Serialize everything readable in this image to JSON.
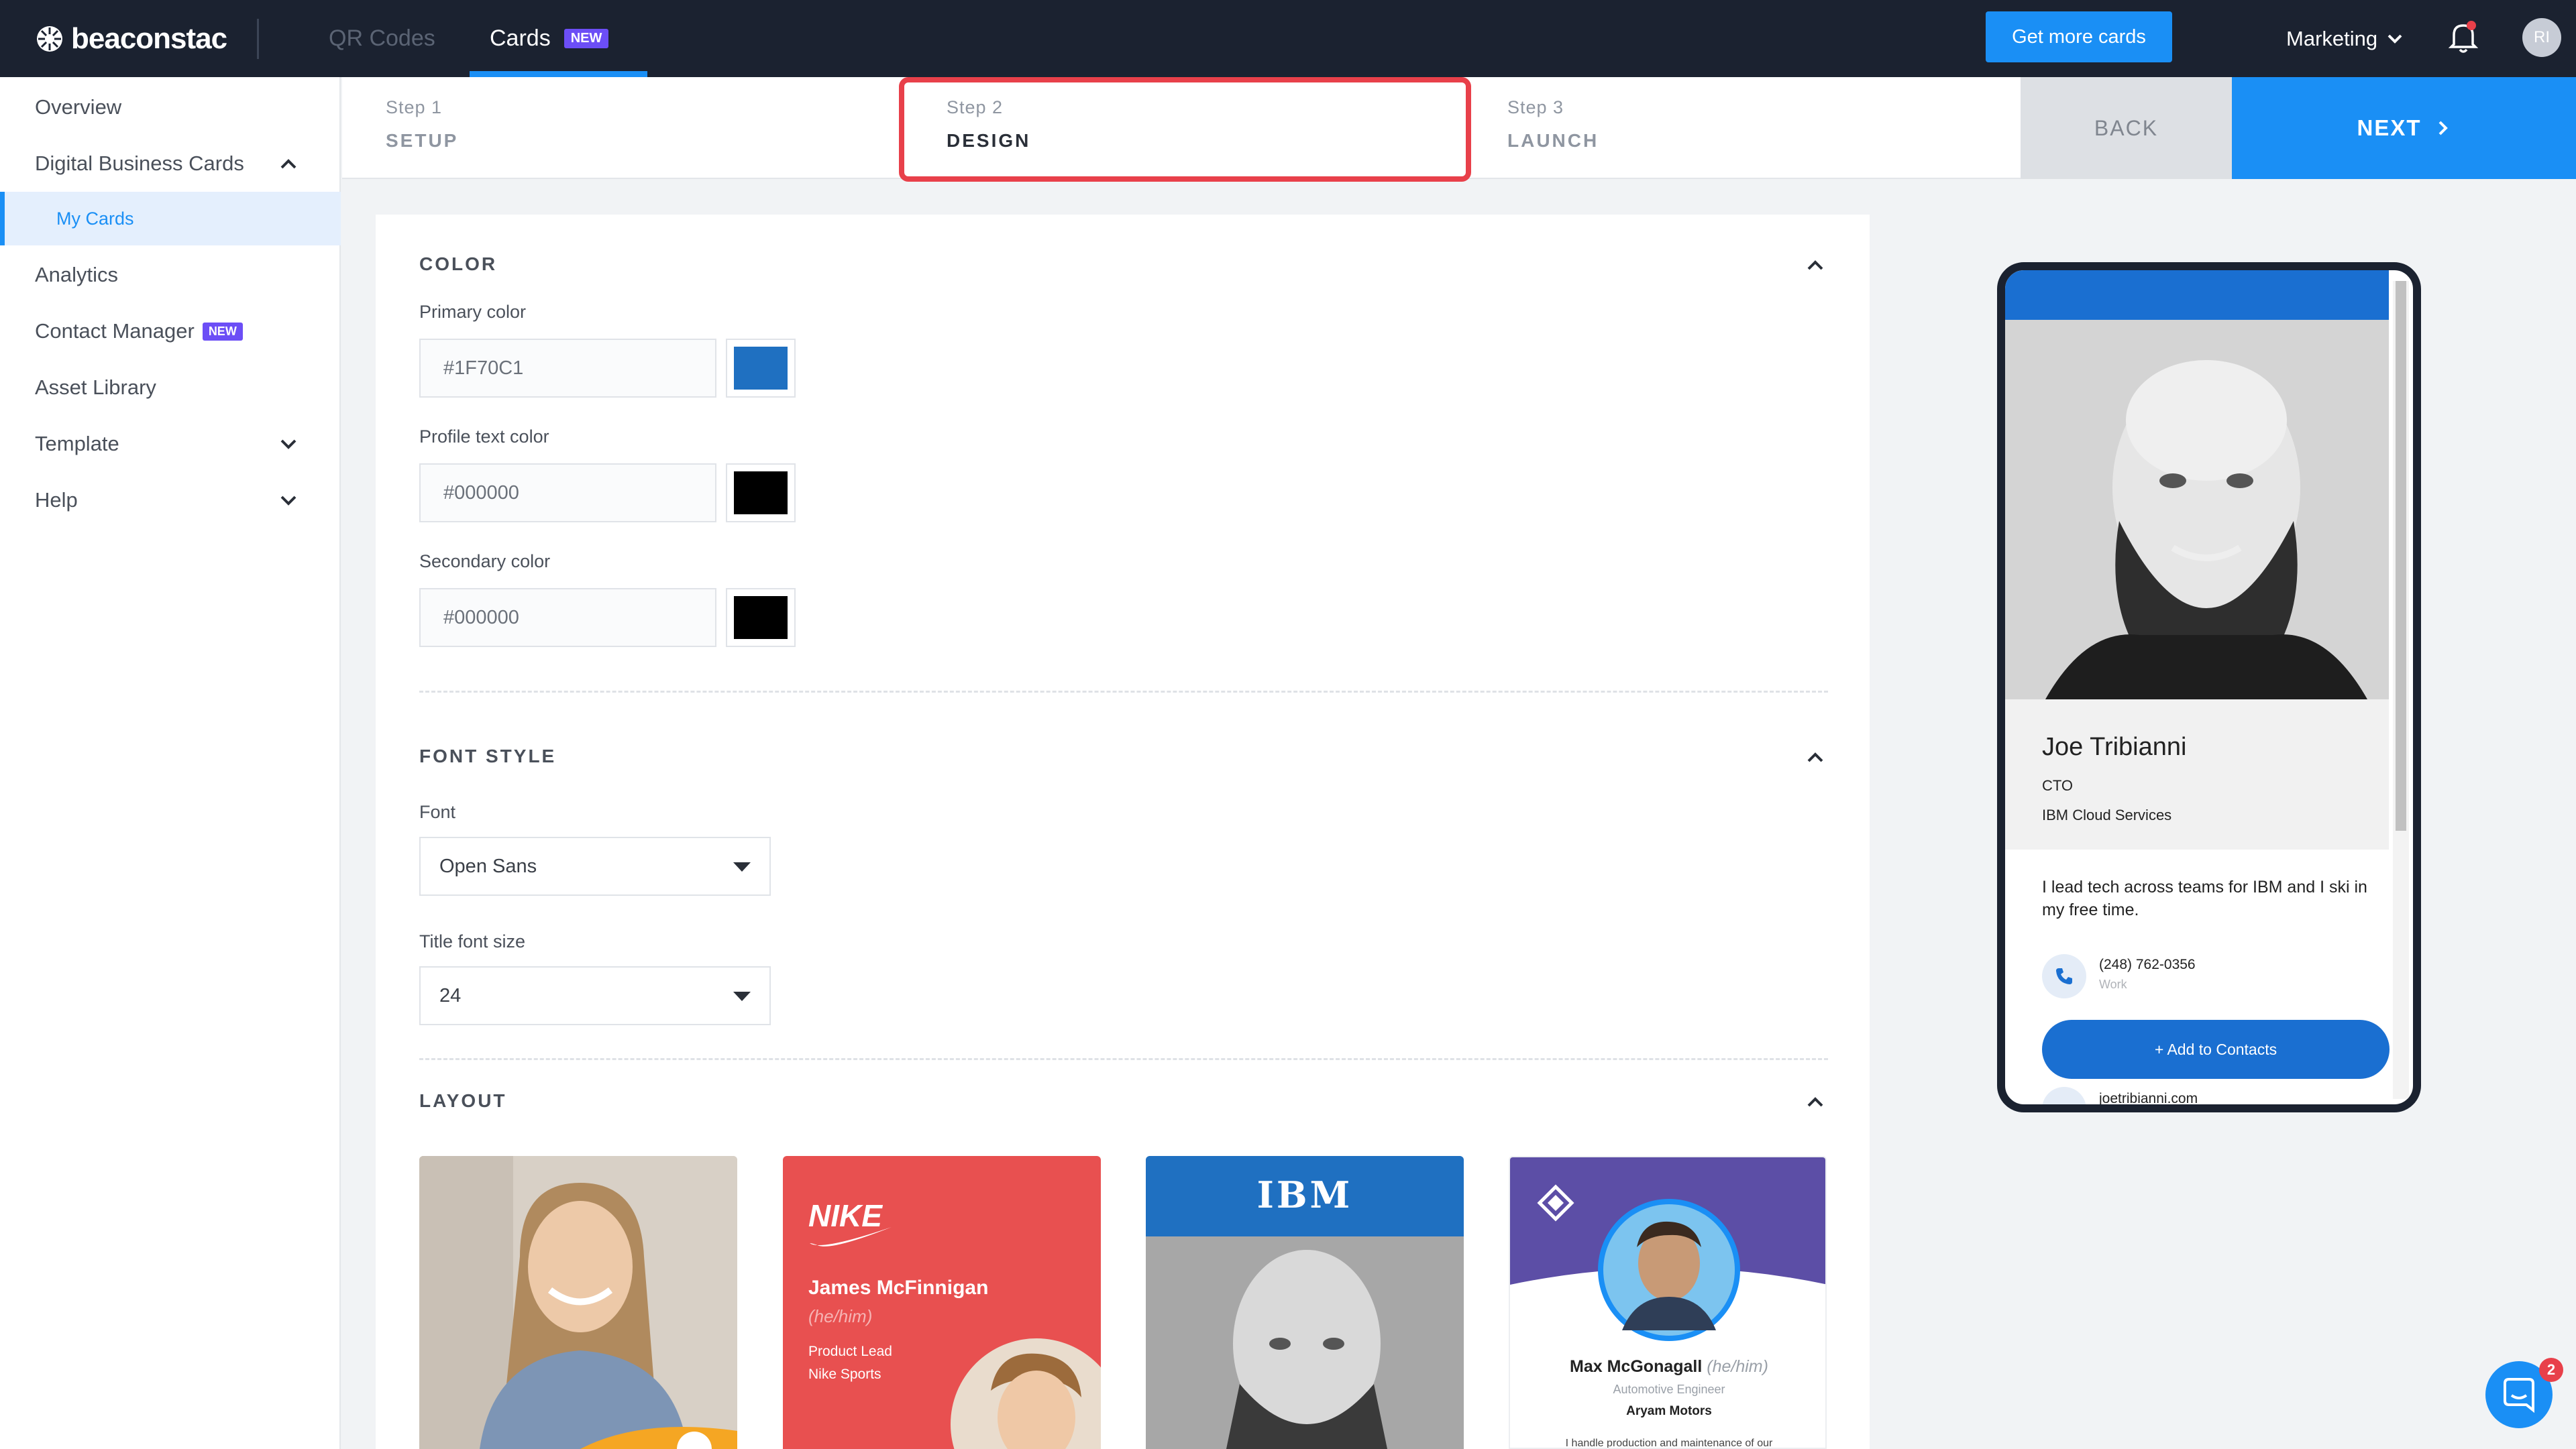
{
  "app": {
    "brand": "beaconstac"
  },
  "topnav": {
    "tabs": [
      {
        "label": "QR Codes"
      },
      {
        "label": "Cards",
        "badge": "NEW"
      }
    ],
    "cta": "Get more cards",
    "workspace": "Marketing",
    "avatar_initials": "RI"
  },
  "sidebar": {
    "items": [
      {
        "label": "Overview"
      },
      {
        "label": "Digital Business Cards"
      },
      {
        "label": "My Cards"
      },
      {
        "label": "Analytics"
      },
      {
        "label": "Contact Manager",
        "badge": "NEW"
      },
      {
        "label": "Asset Library"
      },
      {
        "label": "Template"
      },
      {
        "label": "Help"
      }
    ]
  },
  "steps": [
    {
      "num": "Step 1",
      "name": "SETUP"
    },
    {
      "num": "Step 2",
      "name": "DESIGN"
    },
    {
      "num": "Step 3",
      "name": "LAUNCH"
    }
  ],
  "actions": {
    "back": "BACK",
    "next": "NEXT"
  },
  "color_section": {
    "title": "COLOR",
    "primary_label": "Primary color",
    "primary_value": "#1F70C1",
    "profile_text_label": "Profile text color",
    "profile_text_value": "#000000",
    "secondary_label": "Secondary color",
    "secondary_value": "#000000"
  },
  "font_section": {
    "title": "FONT STYLE",
    "font_label": "Font",
    "font_value": "Open Sans",
    "size_label": "Title font size",
    "size_value": "24"
  },
  "layout_section": {
    "title": "LAYOUT",
    "templates": [
      {
        "logo": "",
        "name": "",
        "pronoun": "",
        "role": "",
        "company": ""
      },
      {
        "logo": "NIKE",
        "name": "James McFinnigan",
        "pronoun": "(he/him)",
        "role": "Product Lead",
        "company": "Nike Sports"
      },
      {
        "logo": "IBM",
        "name": "",
        "pronoun": "",
        "role": "",
        "company": ""
      },
      {
        "logo": "",
        "name": "Max McGonagall",
        "pronoun": "(he/him)",
        "role": "Automotive Engineer",
        "company": "Aryam Motors",
        "bio": "I handle production and maintenance of our"
      }
    ]
  },
  "preview": {
    "name": "Joe Tribianni",
    "title": "CTO",
    "company": "IBM Cloud Services",
    "bio": "I lead tech across teams for IBM and I ski in my free time.",
    "phone": "(248) 762-0356",
    "phone_label": "Work",
    "add_contacts": "+ Add to Contacts",
    "website": "joetribianni.com"
  },
  "chat": {
    "badge": "2"
  },
  "colors": {
    "accent": "#1A8FF5",
    "primary_swatch": "#1F70C1",
    "profile_text_swatch": "#000000",
    "secondary_swatch": "#000000",
    "highlight": "#E8404A",
    "new_badge": "#6C4EF6"
  }
}
